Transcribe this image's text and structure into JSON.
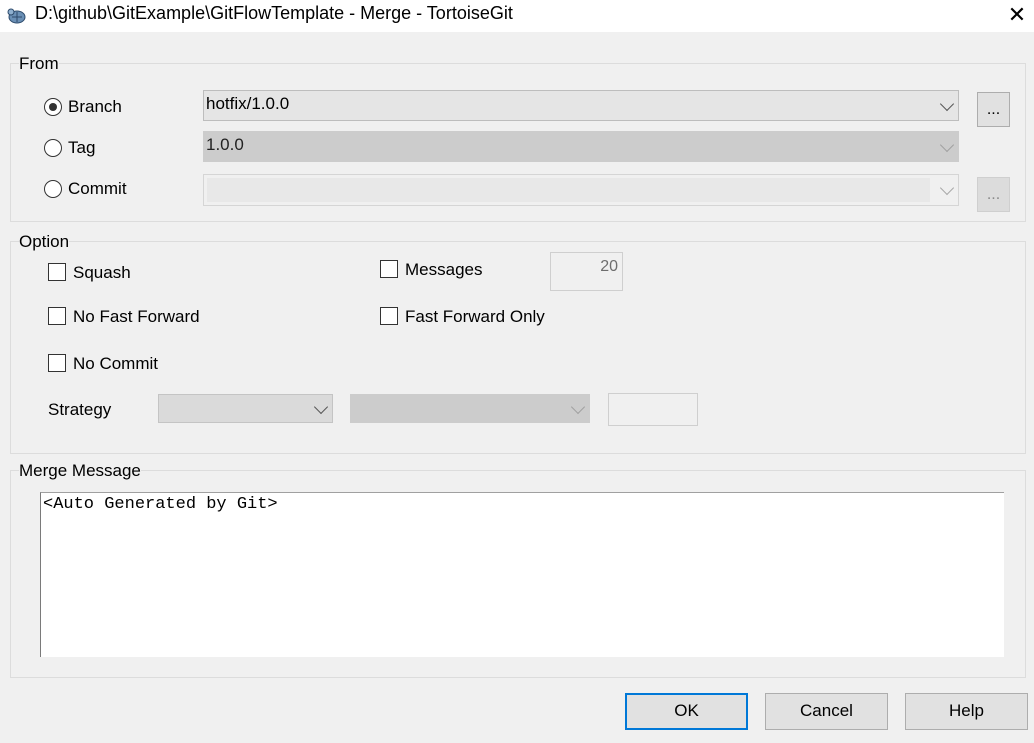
{
  "window": {
    "title": "D:\\github\\GitExample\\GitFlowTemplate - Merge - TortoiseGit",
    "close_glyph": "✕",
    "icon": "tortoisegit-app-icon"
  },
  "from": {
    "group_label": "From",
    "branch": {
      "label": "Branch",
      "selected": true,
      "value": "hotfix/1.0.0",
      "browse_label": "..."
    },
    "tag": {
      "label": "Tag",
      "selected": false,
      "value": "1.0.0"
    },
    "commit": {
      "label": "Commit",
      "selected": false,
      "value": "",
      "browse_label": "..."
    }
  },
  "option": {
    "group_label": "Option",
    "squash": {
      "label": "Squash",
      "checked": false
    },
    "no_fast_forward": {
      "label": "No Fast Forward",
      "checked": false
    },
    "no_commit": {
      "label": "No Commit",
      "checked": false
    },
    "messages": {
      "label": "Messages",
      "checked": false,
      "count": "20"
    },
    "fast_forward_only": {
      "label": "Fast Forward Only",
      "checked": false
    },
    "strategy": {
      "label": "Strategy",
      "strategy_value": "",
      "option_value": "",
      "param_value": ""
    }
  },
  "merge_message": {
    "group_label": "Merge Message",
    "text": "<Auto Generated by Git>"
  },
  "buttons": {
    "ok": "OK",
    "cancel": "Cancel",
    "help": "Help"
  }
}
